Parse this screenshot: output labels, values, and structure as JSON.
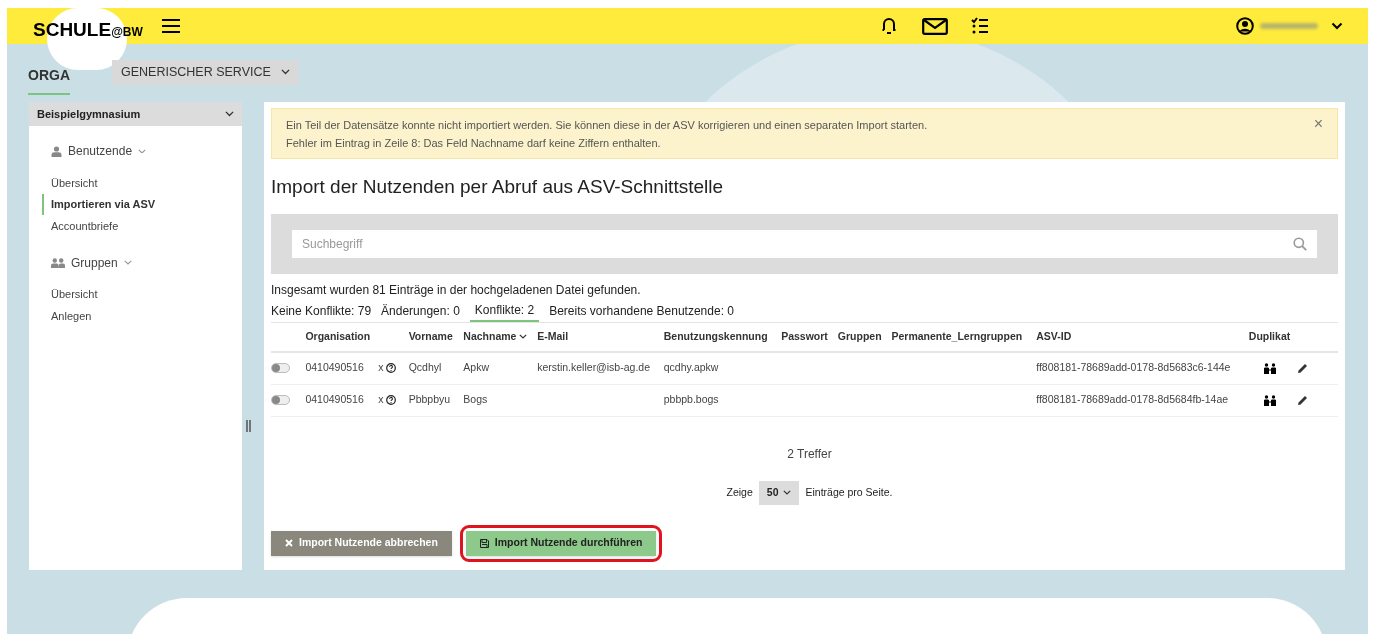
{
  "header": {
    "logo": "SCHULE",
    "logo_suffix": "@BW"
  },
  "subnav": {
    "title": "ORGA",
    "service_menu": "GENERISCHER SERVICE"
  },
  "sidebar": {
    "school": "Beispielgymnasium",
    "sections": [
      {
        "label": "Benutzende",
        "items": [
          {
            "label": "Übersicht",
            "selected": false
          },
          {
            "label": "Importieren via ASV",
            "selected": true
          },
          {
            "label": "Accountbriefe",
            "selected": false
          }
        ]
      },
      {
        "label": "Gruppen",
        "items": [
          {
            "label": "Übersicht",
            "selected": false
          },
          {
            "label": "Anlegen",
            "selected": false
          }
        ]
      }
    ]
  },
  "alert": {
    "lines": [
      "Ein Teil der Datensätze konnte nicht importiert werden. Sie können diese in der ASV korrigieren und einen separaten Import starten.",
      "Fehler im Eintrag in Zeile 8: Das Feld Nachname darf keine Ziffern enthalten."
    ],
    "close": "×"
  },
  "page_title": "Import der Nutzenden per Abruf aus ASV-Schnittstelle",
  "search": {
    "placeholder": "Suchbegriff"
  },
  "summary": "Insgesamt wurden 81 Einträge in der hochgeladenen Datei gefunden.",
  "filter_tabs": [
    {
      "label": "Keine Konflikte: 79",
      "selected": false
    },
    {
      "label": "Änderungen: 0",
      "selected": false
    },
    {
      "label": "Konflikte: 2",
      "selected": true
    },
    {
      "label": "Bereits vorhandene Benutzende: 0",
      "selected": false
    }
  ],
  "table": {
    "columns": [
      "Organisation",
      "Vorname",
      "Nachname",
      "E-Mail",
      "Benutzungskennung",
      "Passwort",
      "Gruppen",
      "Permanente_Lerngruppen",
      "ASV-ID",
      "Duplikat"
    ],
    "rows": [
      {
        "on": false,
        "organisation": "0410490516",
        "mark": "x",
        "vorname": "Qcdhyl",
        "nachname": "Apkw",
        "email": "kerstin.keller@isb-ag.de",
        "kennung": "qcdhy.apkw",
        "asv_id": "ff808181-78689add-0178-8d5683c6-144e"
      },
      {
        "on": false,
        "organisation": "0410490516",
        "mark": "x",
        "vorname": "Pbbpbyu",
        "nachname": "Bogs",
        "kennung": "pbbpb.bogs",
        "asv_id": "ff808181-78689add-0178-8d5684fb-14ae"
      }
    ]
  },
  "hits": "2 Treffer",
  "paging": {
    "before": "Zeige",
    "page_size": "50",
    "after": "Einträge pro Seite."
  },
  "buttons": [
    {
      "kind": "cancel",
      "label": "Import Nutzende abbrechen",
      "highlighted": false
    },
    {
      "kind": "execute",
      "label": "Import Nutzende durchführen",
      "highlighted": true
    }
  ]
}
